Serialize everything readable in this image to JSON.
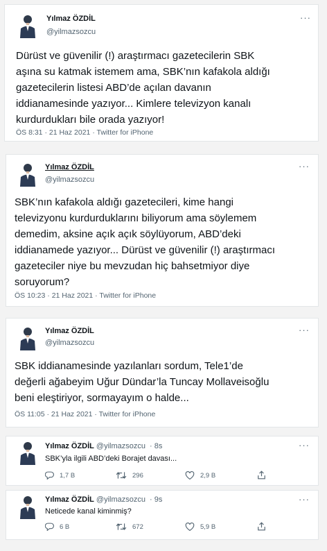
{
  "author": {
    "name": "Yılmaz ÖZDİL",
    "handle": "@yilmazsozcu"
  },
  "tweets": [
    {
      "lines": [
        "Dürüst ve güvenilir (!) araştırmacı gazetecilerin SBK",
        "aşına su katmak istemem ama, SBK’nın kafakola aldığı",
        "gazetecilerin listesi ABD’de açılan davanın",
        "iddianamesinde yazıyor... Kimlere televizyon kanalı",
        "kurdurdukları bile orada yazıyor!"
      ],
      "meta": "ÖS 8:31 · 21 Haz 2021 · Twitter for iPhone"
    },
    {
      "lines": [
        "SBK’nın kafakola aldığı gazetecileri, kime hangi",
        "televizyonu kurdurduklarını biliyorum ama söylemem",
        "demedim, aksine açık açık söylüyorum, ABD’deki",
        "iddianamede yazıyor... Dürüst ve güvenilir (!) araştırmacı",
        "gazeteciler niye bu mevzudan hiç bahsetmiyor diye",
        "soruyorum?"
      ],
      "meta": "ÖS 10:23 · 21 Haz 2021 · Twitter for iPhone"
    },
    {
      "lines": [
        "SBK iddianamesinde yazılanları sordum, Tele1’de",
        "değerli ağabeyim Uğur Dündar’la Tuncay Mollaveisoğlu",
        "beni eleştiriyor, sormayayım o halde..."
      ],
      "meta": "ÖS 11:05 · 21 Haz 2021 · Twitter for iPhone"
    }
  ],
  "replies": [
    {
      "time": "· 8s",
      "text": "SBK’yla ilgili ABD’deki Borajet davası...",
      "reply_count": "1,7 B",
      "retweet_count": "296",
      "like_count": "2,9 B"
    },
    {
      "time": "· 9s",
      "text": "Neticede kanal kiminmiş?",
      "reply_count": "6 B",
      "retweet_count": "672",
      "like_count": "5,9 B"
    }
  ],
  "icons": {
    "more": "more-dots-icon",
    "reply": "reply-icon",
    "retweet": "retweet-icon",
    "like": "heart-icon",
    "share": "share-icon"
  },
  "more_symbol": "···",
  "colors": {
    "text": "#0f1419",
    "secondary": "#536471",
    "background": "#f3f3f3",
    "card": "#ffffff"
  }
}
